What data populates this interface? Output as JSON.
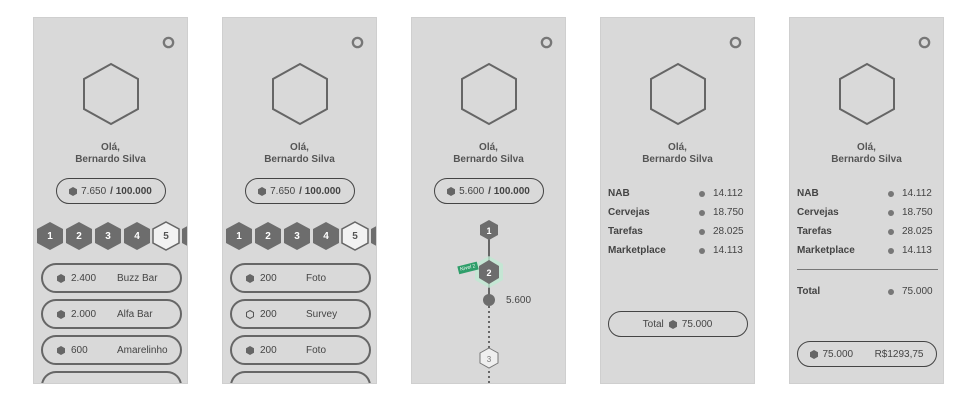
{
  "greeting": {
    "hello": "Olá,",
    "name": "Bernardo Silva"
  },
  "screen1": {
    "points": "7.650",
    "max": "/ 100.000",
    "levels": [
      "1",
      "2",
      "3",
      "4",
      "5"
    ],
    "rewards": [
      {
        "value": "2.400",
        "label": "Buzz Bar"
      },
      {
        "value": "2.000",
        "label": "Alfa Bar"
      },
      {
        "value": "600",
        "label": "Amarelinho"
      }
    ]
  },
  "screen2": {
    "points": "7.650",
    "max": "/ 100.000",
    "levels": [
      "1",
      "2",
      "3",
      "4",
      "5"
    ],
    "missions": [
      {
        "value": "200",
        "label": "Foto",
        "filled": true
      },
      {
        "value": "200",
        "label": "Survey",
        "filled": false
      },
      {
        "value": "200",
        "label": "Foto",
        "filled": true
      }
    ]
  },
  "screen3": {
    "points": "5.600",
    "max": "/ 100.000",
    "steps": [
      "1",
      "2",
      "3"
    ],
    "current_amount": "5.600",
    "tooltip": "Nível 2"
  },
  "screen4": {
    "items": [
      {
        "name": "NAB",
        "value": "14.112"
      },
      {
        "name": "Cervejas",
        "value": "18.750"
      },
      {
        "name": "Tarefas",
        "value": "28.025"
      },
      {
        "name": "Marketplace",
        "value": "14.113"
      }
    ],
    "total_label": "Total",
    "total_value": "75.000"
  },
  "screen5": {
    "items": [
      {
        "name": "NAB",
        "value": "14.112"
      },
      {
        "name": "Cervejas",
        "value": "18.750"
      },
      {
        "name": "Tarefas",
        "value": "28.025"
      },
      {
        "name": "Marketplace",
        "value": "14.113"
      }
    ],
    "total_label": "Total",
    "total_value": "75.000",
    "convert_points": "75.000",
    "convert_money": "R$1293,75"
  },
  "colors": {
    "filled_hex": "#6d6d6d",
    "accent_green": "#2f9e6a",
    "background": "#d9d9d9"
  }
}
